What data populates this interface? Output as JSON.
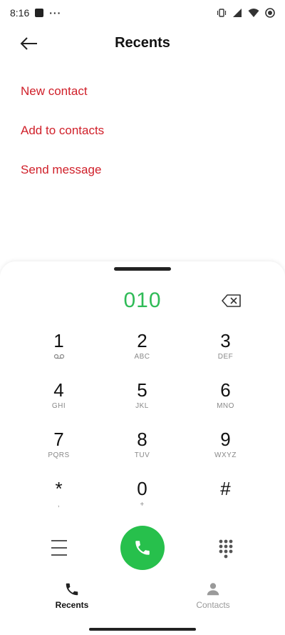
{
  "status_bar": {
    "time": "8:16",
    "dots": "···"
  },
  "header": {
    "title": "Recents"
  },
  "actions": [
    {
      "label": "New contact"
    },
    {
      "label": "Add to contacts"
    },
    {
      "label": "Send message"
    }
  ],
  "dialpad": {
    "number": "010",
    "keys": [
      {
        "digit": "1",
        "letters": ""
      },
      {
        "digit": "2",
        "letters": "ABC"
      },
      {
        "digit": "3",
        "letters": "DEF"
      },
      {
        "digit": "4",
        "letters": "GHI"
      },
      {
        "digit": "5",
        "letters": "JKL"
      },
      {
        "digit": "6",
        "letters": "MNO"
      },
      {
        "digit": "7",
        "letters": "PQRS"
      },
      {
        "digit": "8",
        "letters": "TUV"
      },
      {
        "digit": "9",
        "letters": "WXYZ"
      },
      {
        "digit": "*",
        "letters": ","
      },
      {
        "digit": "0",
        "letters": "+"
      },
      {
        "digit": "#",
        "letters": ""
      }
    ]
  },
  "bottom_nav": {
    "recents_label": "Recents",
    "contacts_label": "Contacts"
  },
  "colors": {
    "accent_red": "#d0202a",
    "number_green": "#2fbb57",
    "call_green": "#27c04c"
  },
  "icons": [
    "back-arrow-icon",
    "backspace-icon",
    "voicemail-icon",
    "menu-icon",
    "phone-icon",
    "dialpad-grid-icon",
    "person-icon",
    "vibrate-icon",
    "signal-icon",
    "wifi-icon",
    "battery-icon"
  ]
}
